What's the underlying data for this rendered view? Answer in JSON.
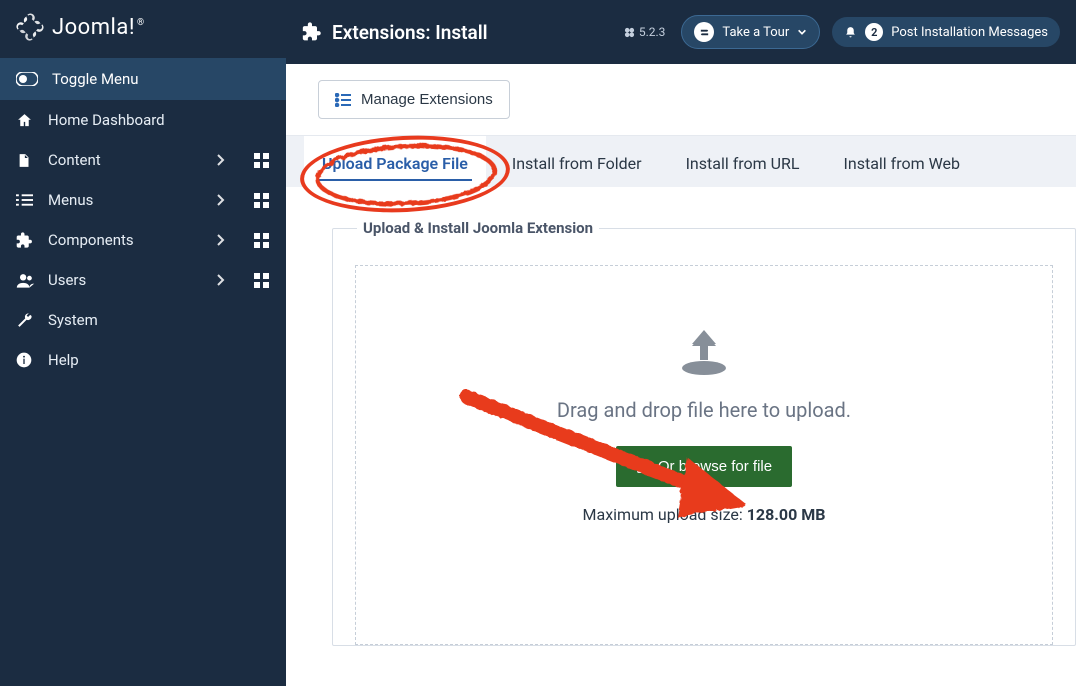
{
  "brand": "Joomla!",
  "toggle_label": "Toggle Menu",
  "nav": [
    {
      "icon": "home",
      "label": "Home Dashboard",
      "chev": false,
      "grid": false
    },
    {
      "icon": "file",
      "label": "Content",
      "chev": true,
      "grid": true
    },
    {
      "icon": "list",
      "label": "Menus",
      "chev": true,
      "grid": true
    },
    {
      "icon": "puzzle",
      "label": "Components",
      "chev": true,
      "grid": true
    },
    {
      "icon": "users",
      "label": "Users",
      "chev": true,
      "grid": true
    },
    {
      "icon": "wrench",
      "label": "System",
      "chev": false,
      "grid": false
    },
    {
      "icon": "info",
      "label": "Help",
      "chev": false,
      "grid": false
    }
  ],
  "header": {
    "title": "Extensions: Install",
    "version": "5.2.3",
    "tour_label": "Take a Tour",
    "notif_count": "2",
    "post_install": "Post Installation Messages"
  },
  "toolbar": {
    "manage_label": "Manage Extensions"
  },
  "tabs": [
    {
      "label": "Upload Package File",
      "active": true
    },
    {
      "label": "Install from Folder",
      "active": false
    },
    {
      "label": "Install from URL",
      "active": false
    },
    {
      "label": "Install from Web",
      "active": false
    }
  ],
  "upload": {
    "legend": "Upload & Install Joomla Extension",
    "drop_text": "Drag and drop file here to upload.",
    "browse_label": "Or browse for file",
    "max_label": "Maximum upload size: ",
    "max_value": "128.00 MB"
  }
}
